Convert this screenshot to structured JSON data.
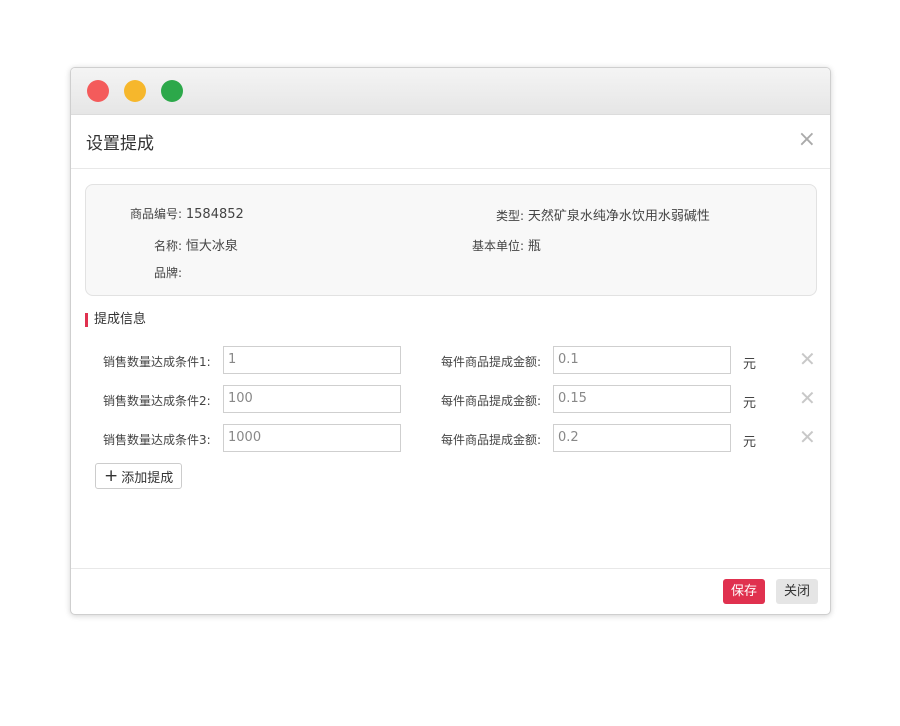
{
  "dialog": {
    "title": "设置提成",
    "close_icon": "×"
  },
  "product": {
    "code_label": "商品编号:",
    "code_value": "1584852",
    "type_label": "类型:",
    "type_value": "天然矿泉水纯净水饮用水弱碱性",
    "name_label": "名称:",
    "name_value": "恒大冰泉",
    "unit_label": "基本单位:",
    "unit_value": "瓶",
    "brand_label": "品牌:",
    "brand_value": ""
  },
  "section": {
    "title": "提成信息"
  },
  "conditions": [
    {
      "label": "销售数量达成条件1:",
      "qty": "1",
      "amount_label": "每件商品提成金额:",
      "amount": "0.1",
      "unit": "元"
    },
    {
      "label": "销售数量达成条件2:",
      "qty": "100",
      "amount_label": "每件商品提成金额:",
      "amount": "0.15",
      "unit": "元"
    },
    {
      "label": "销售数量达成条件3:",
      "qty": "1000",
      "amount_label": "每件商品提成金额:",
      "amount": "0.2",
      "unit": "元"
    }
  ],
  "add_button": {
    "label": "添加提成"
  },
  "footer": {
    "save_label": "保存",
    "close_label": "关闭"
  },
  "colors": {
    "accent": "#e0314f",
    "dot_red": "#f45b5b",
    "dot_yellow": "#f6b72c",
    "dot_green": "#2ca84a"
  }
}
